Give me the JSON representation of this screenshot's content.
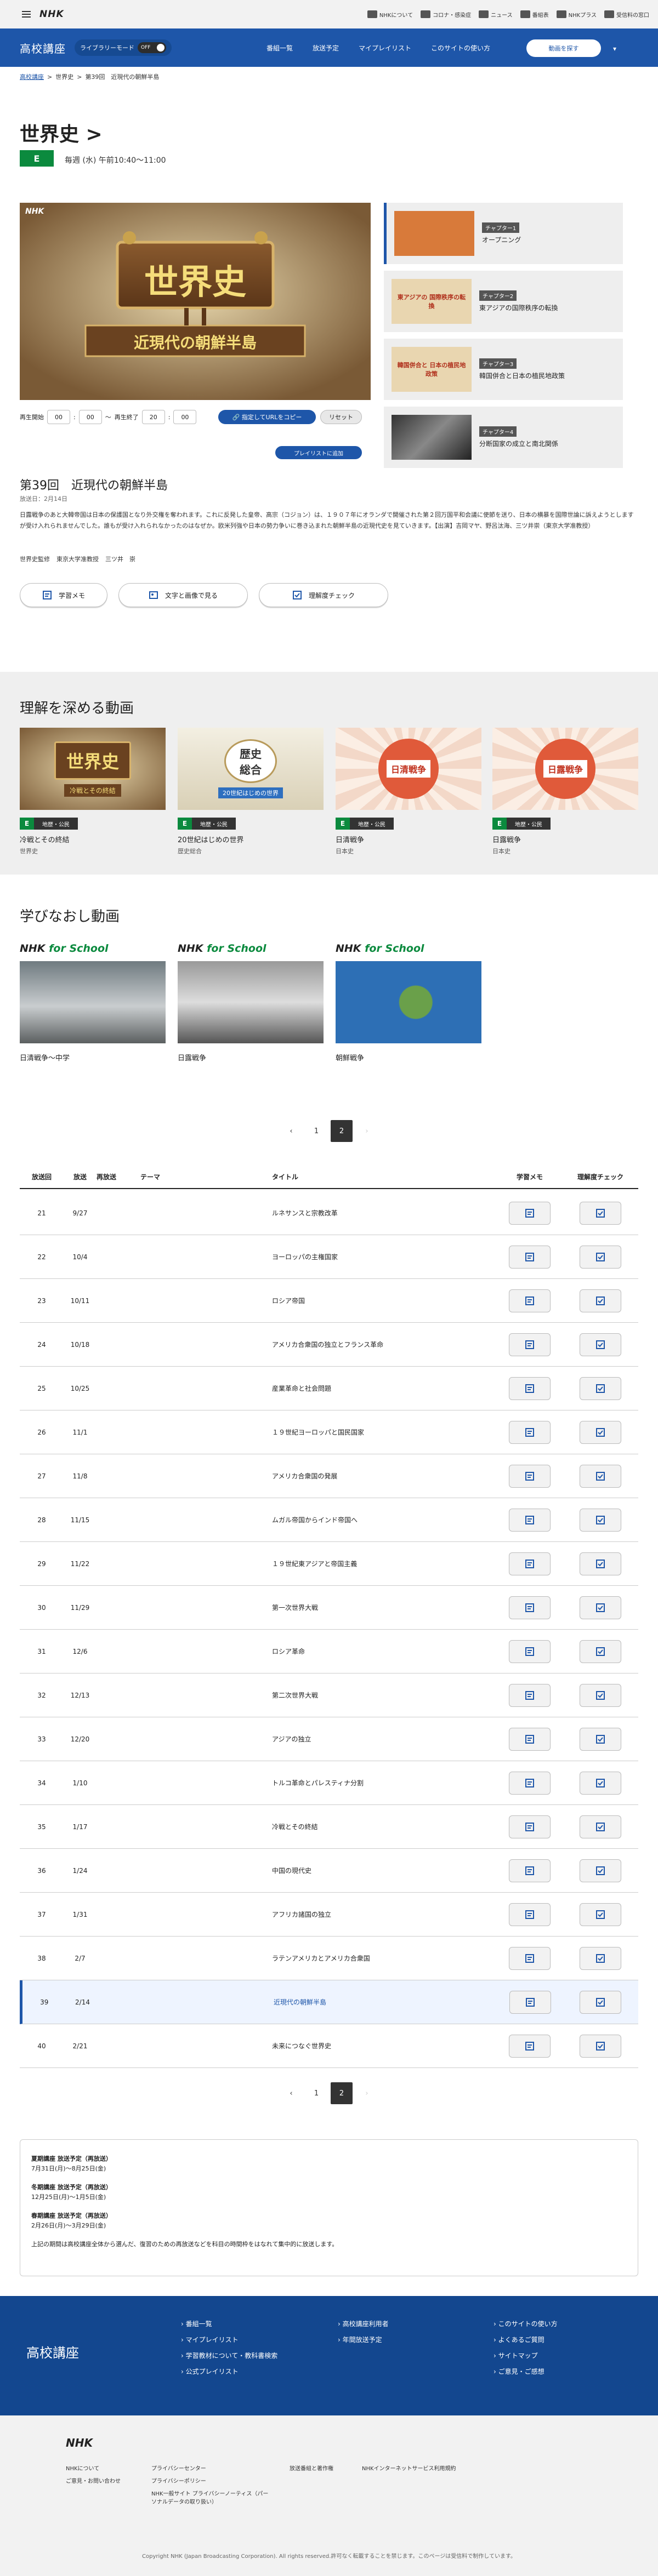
{
  "topbar": {
    "logo": "NHK",
    "links": [
      "NHKについて",
      "コロナ・感染症",
      "ニュース",
      "番組表",
      "NHKプラス",
      "受信料の窓口"
    ]
  },
  "header": {
    "logo": "高校講座",
    "library_mode_label": "ライブラリーモード",
    "toggle_state": "OFF",
    "nav": [
      "番組一覧",
      "放送予定",
      "マイプレイリスト",
      "このサイトの使い方"
    ],
    "search_button": "動画を探す",
    "chevron": "▾"
  },
  "breadcrumb": [
    "高校講座",
    "世界史",
    "第39回　近現代の朝鮮半島"
  ],
  "breadcrumb_sep": ">",
  "program": {
    "title": "世界史 >",
    "channel_badge": "E",
    "airtime": "毎週 (水) 午前10:40～11:00"
  },
  "player": {
    "nhk_mark": "NHK",
    "thumb_title": "世界史",
    "thumb_subtitle": "近現代の朝鮮半島",
    "ctrl_start_label": "再生開始",
    "ctrl_start_min": "00",
    "ctrl_start_sec": "00",
    "ctrl_tilde": "〜",
    "ctrl_end_label": "再生終了",
    "ctrl_end_min": "20",
    "ctrl_end_sec": "00",
    "colon": ":",
    "copy_url_button": "🔗 指定してURLをコピー",
    "reset_button": "リセット",
    "add_playlist_button": "プレイリストに追加"
  },
  "chapters": [
    {
      "tag": "チャプター1",
      "title": "オープニング",
      "thumb_text": ""
    },
    {
      "tag": "チャプター2",
      "title": "東アジアの国際秩序の転換",
      "thumb_text": "東アジアの 国際秩序の転換"
    },
    {
      "tag": "チャプター3",
      "title": "韓国併合と日本の植民地政策",
      "thumb_text": "韓国併合と 日本の植民地政策"
    },
    {
      "tag": "チャプター4",
      "title": "分断国家の成立と南北関係",
      "thumb_text": ""
    }
  ],
  "episode": {
    "title": "第39回　近現代の朝鮮半島",
    "date": "放送日：2月14日",
    "description": "日露戦争のあと大韓帝国は日本の保護国となり外交権を奪われます。これに反発した皇帝、高宗（コジョン）は、１９０７年にオランダで開催された第２回万国平和会議に使節を送り、日本の横暴を国際世論に訴えようとしますが受け入れられませんでした。誰もが受け入れられなかったのはなぜか。欧米列強や日本の勢力争いに巻き込まれた朝鮮半島の近現代史を見ていきます。【出演】吉岡マヤ、野呂汰海、三ツ井崇（東京大学准教授）",
    "staff_label": "世界史監修",
    "staff_org": "東京大学准教授",
    "staff_name": "三ツ井　崇",
    "buttons": [
      "学習メモ",
      "文字と画像で見る",
      "理解度チェック"
    ]
  },
  "related": {
    "heading": "理解を深める動画",
    "badge_e": "E",
    "cards": [
      {
        "genre": "地歴・公民",
        "title": "冷戦とその終結",
        "series": "世界史",
        "thumb": "sekaishi",
        "thumb_sub": "冷戦とその終結"
      },
      {
        "genre": "地歴・公民",
        "title": "20世紀はじめの世界",
        "series": "歴史総合",
        "thumb": "rekishi",
        "thumb_sub": "20世紀はじめの世界"
      },
      {
        "genre": "地歴・公民",
        "title": "日清戦争",
        "series": "日本史",
        "thumb": "nisshin",
        "thumb_sub": "日清戦争"
      },
      {
        "genre": "地歴・公民",
        "title": "日露戦争",
        "series": "日本史",
        "thumb": "nichiro",
        "thumb_sub": "日露戦争"
      }
    ]
  },
  "review": {
    "heading": "学びなおし動画",
    "brand_a": "NHK",
    "brand_b": "for School",
    "cards": [
      {
        "title": "日清戦争～中学"
      },
      {
        "title": "日露戦争"
      },
      {
        "title": "朝鮮戦争"
      }
    ]
  },
  "pager": {
    "prev": "‹",
    "pages": [
      "1",
      "2"
    ],
    "current": "2",
    "next": "›"
  },
  "table": {
    "headers": [
      "放送回",
      "放送",
      "再放送",
      "テーマ",
      "タイトル",
      "学習メモ",
      "理解度チェック"
    ],
    "rows": [
      {
        "no": "21",
        "date": "9/27",
        "title": "ルネサンスと宗教改革"
      },
      {
        "no": "22",
        "date": "10/4",
        "title": "ヨーロッパの主権国家"
      },
      {
        "no": "23",
        "date": "10/11",
        "title": "ロシア帝国"
      },
      {
        "no": "24",
        "date": "10/18",
        "title": "アメリカ合衆国の独立とフランス革命"
      },
      {
        "no": "25",
        "date": "10/25",
        "title": "産業革命と社会問題"
      },
      {
        "no": "26",
        "date": "11/1",
        "title": "１９世紀ヨーロッパと国民国家"
      },
      {
        "no": "27",
        "date": "11/8",
        "title": "アメリカ合衆国の発展"
      },
      {
        "no": "28",
        "date": "11/15",
        "title": "ムガル帝国からインド帝国へ"
      },
      {
        "no": "29",
        "date": "11/22",
        "title": "１９世紀東アジアと帝国主義"
      },
      {
        "no": "30",
        "date": "11/29",
        "title": "第一次世界大戦"
      },
      {
        "no": "31",
        "date": "12/6",
        "title": "ロシア革命"
      },
      {
        "no": "32",
        "date": "12/13",
        "title": "第二次世界大戦"
      },
      {
        "no": "33",
        "date": "12/20",
        "title": "アジアの独立"
      },
      {
        "no": "34",
        "date": "1/10",
        "title": "トルコ革命とパレスティナ分割"
      },
      {
        "no": "35",
        "date": "1/17",
        "title": "冷戦とその終結"
      },
      {
        "no": "36",
        "date": "1/24",
        "title": "中国の現代史"
      },
      {
        "no": "37",
        "date": "1/31",
        "title": "アフリカ諸国の独立"
      },
      {
        "no": "38",
        "date": "2/7",
        "title": "ラテンアメリカとアメリカ合衆国"
      },
      {
        "no": "39",
        "date": "2/14",
        "title": "近現代の朝鮮半島"
      },
      {
        "no": "40",
        "date": "2/21",
        "title": "未来につなぐ世界史"
      }
    ],
    "selected_no": "39"
  },
  "schedule": {
    "summer_head": "夏期講座 放送予定（再放送）",
    "summer_dates": "7月31日(月)～8月25日(金)",
    "winter_head": "冬期講座 放送予定（再放送）",
    "winter_dates": "12月25日(月)～1月5日(金)",
    "spring_head": "春期講座 放送予定（再放送）",
    "spring_dates": "2月26日(月)～3月29日(金)",
    "note": "上記の期間は高校講座全体から選んだ、復習のための再放送などを科目の時間枠をはなれて集中的に放送します。"
  },
  "footer": {
    "logo": "高校講座",
    "col1": [
      "番組一覧",
      "マイプレイリスト",
      "学習教材について・教科書検索",
      "公式プレイリスト"
    ],
    "col2": [
      "高校講座利用者",
      "年間放送予定"
    ],
    "col3": [
      "このサイトの使い方",
      "よくあるご質問",
      "サイトマップ",
      "ご意見・ご感想"
    ],
    "bullet": "›"
  },
  "bottom": {
    "logo": "NHK",
    "col1": [
      "NHKについて",
      "ご意見・お問い合わせ"
    ],
    "col2": [
      "プライバシーセンター",
      "プライバシーポリシー",
      "NHK一般サイト プライバシーノーティス（パーソナルデータの取り扱い）"
    ],
    "col3": [
      "放送番組と著作権"
    ],
    "col4": [
      "NHKインターネットサービス利用規約"
    ],
    "copyright": "Copyright NHK (Japan Broadcasting Corporation). All rights reserved.許可なく転載することを禁じます。このページは受信料で制作しています。"
  },
  "colors": {
    "brand_blue": "#1e56a9",
    "e_green": "#0b8a3e",
    "footer_blue": "#13478f"
  }
}
